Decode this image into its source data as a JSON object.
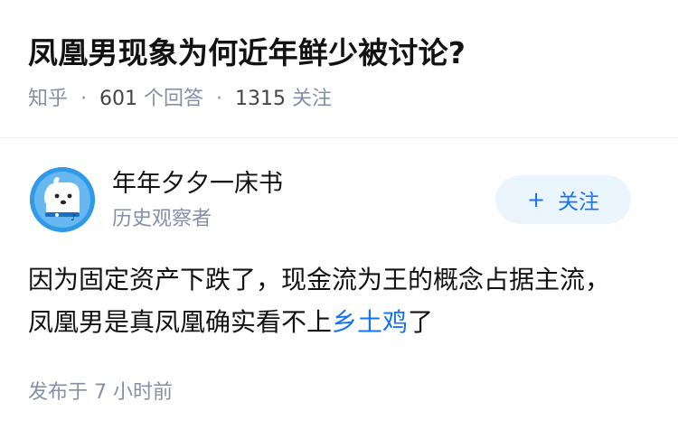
{
  "question": {
    "title": "凤凰男现象为何近年鲜少被讨论?",
    "source": "知乎",
    "answer_count": "601",
    "answer_label": "个回答",
    "follower_count": "1315",
    "follower_label": "关注"
  },
  "author": {
    "name": "年年夕夕一床书",
    "bio": "历史观察者",
    "follow_label": "关注",
    "avatar_icon": "dog-avatar-icon"
  },
  "answer": {
    "text_before_link": "因为固定资产下跌了，现金流为王的概念占据主流，凤凰男是真凤凰确实看不上",
    "link_text": "乡土鸡",
    "text_after_link": "了",
    "time_prefix": "发布于",
    "time_value": "7 小时前"
  },
  "colors": {
    "accent": "#1772f6",
    "follow_bg": "#ebf5fd",
    "meta_gray": "#8590a6",
    "avatar_blue": "#2f9ae8"
  }
}
